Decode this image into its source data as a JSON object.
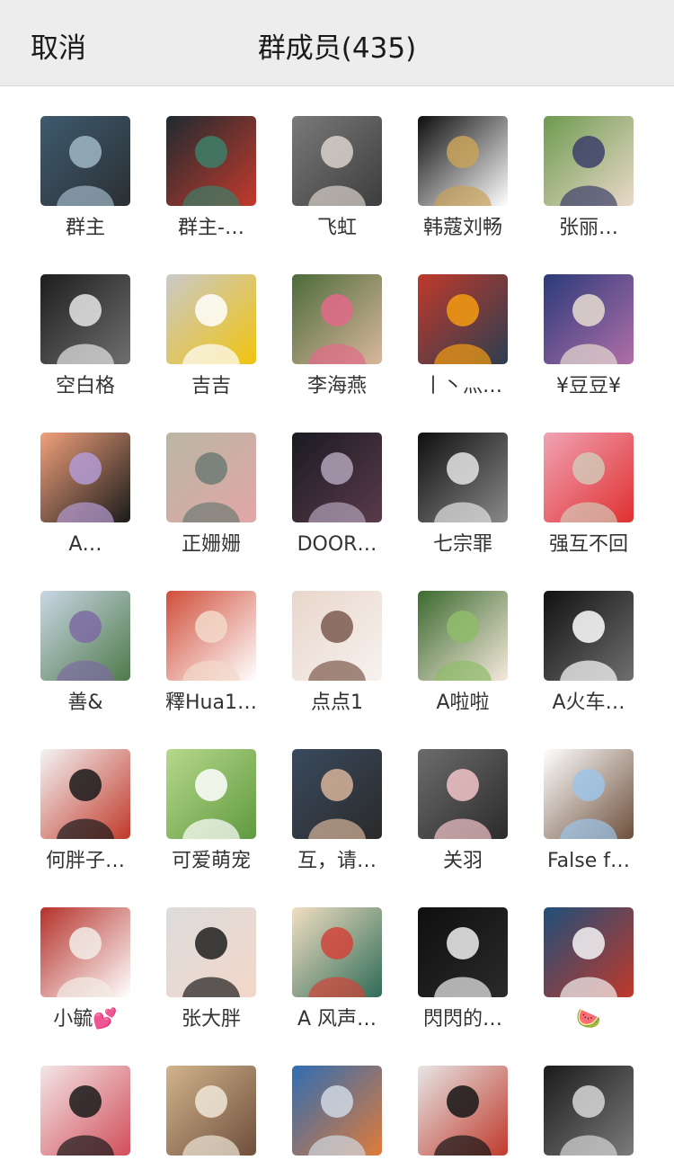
{
  "header": {
    "cancel_label": "取消",
    "title": "群成员(435)"
  },
  "members": [
    {
      "name": "群主",
      "avatar": "steering-wheel-photo",
      "palette": [
        "#3e5b6f",
        "#9fb7c6",
        "#2b2f33"
      ]
    },
    {
      "name": "群主-…",
      "avatar": "man-on-stage-photo",
      "palette": [
        "#1e2a30",
        "#3d7f6a",
        "#c33a2c"
      ]
    },
    {
      "name": "飞虹",
      "avatar": "girl-portrait-photo",
      "palette": [
        "#7a7a7a",
        "#d9d1cb",
        "#3d3d3d"
      ]
    },
    {
      "name": "韩蔻刘畅",
      "avatar": "han-korra-logo",
      "palette": [
        "#0d0d0d",
        "#c9a25a",
        "#ffffff"
      ]
    },
    {
      "name": "张丽…",
      "avatar": "family-lawn-photo",
      "palette": [
        "#6d9a4f",
        "#3c3f6a",
        "#ead9c9"
      ]
    },
    {
      "name": "空白格",
      "avatar": "bw-portrait-photo",
      "palette": [
        "#1d1d1d",
        "#e6e6e6",
        "#6f6f6f"
      ]
    },
    {
      "name": "吉吉",
      "avatar": "bunny-cartoon",
      "palette": [
        "#c9c9c9",
        "#ffffff",
        "#f1c40f"
      ]
    },
    {
      "name": "李海燕",
      "avatar": "woman-in-pink-photo",
      "palette": [
        "#4c6b3a",
        "#e26a8a",
        "#d9b79c"
      ]
    },
    {
      "name": "丨丶灬…",
      "avatar": "anime-couple-art",
      "palette": [
        "#c0392b",
        "#f39c12",
        "#2c3e50"
      ]
    },
    {
      "name": "¥豆豆¥",
      "avatar": "child-in-coat-photo",
      "palette": [
        "#2b3a7a",
        "#e7dcd2",
        "#b06fa8"
      ]
    },
    {
      "name": "A…",
      "avatar": "cartoon-girl-sunset",
      "palette": [
        "#f1a07b",
        "#b39bd3",
        "#1a1a1a"
      ]
    },
    {
      "name": "正姗姗",
      "avatar": "child-on-beach-photo",
      "palette": [
        "#b9b7a3",
        "#6d7b74",
        "#e2a6a6"
      ]
    },
    {
      "name": "DOOR…",
      "avatar": "fashion-collage-photo",
      "palette": [
        "#1a1a22",
        "#b2a2b9",
        "#5a3b4b"
      ]
    },
    {
      "name": "七宗罪",
      "avatar": "anime-boy-sketch",
      "palette": [
        "#0f0f0f",
        "#e4e4e4",
        "#8a8a8a"
      ]
    },
    {
      "name": "强互不回",
      "avatar": "mom-and-child-photo",
      "palette": [
        "#f0a3b4",
        "#d4c7b6",
        "#e03030"
      ]
    },
    {
      "name": "善&",
      "avatar": "lavender-field-photo",
      "palette": [
        "#c9d6e4",
        "#7d6ba3",
        "#4f7a4a"
      ]
    },
    {
      "name": "釋Hua1…",
      "avatar": "young-woman-selfie",
      "palette": [
        "#d14e3a",
        "#f2d9c9",
        "#ffffff"
      ]
    },
    {
      "name": "点点1",
      "avatar": "braided-hair-photo",
      "palette": [
        "#e8d6cb",
        "#7d5a4d",
        "#f7f2ef"
      ]
    },
    {
      "name": "A啦啦",
      "avatar": "deer-antler-girl-photo",
      "palette": [
        "#3c6a2f",
        "#8fbc6a",
        "#f5e9dc"
      ]
    },
    {
      "name": "A火车…",
      "avatar": "hui-jia-banner",
      "palette": [
        "#111111",
        "#ffffff",
        "#6f6f6f"
      ]
    },
    {
      "name": "何胖子…",
      "avatar": "calligraphy-chu-xin",
      "palette": [
        "#f4f4f4",
        "#1a1a1a",
        "#c0392b"
      ]
    },
    {
      "name": "可爱萌宠",
      "avatar": "wipes-package-photo",
      "palette": [
        "#b7d88b",
        "#ffffff",
        "#5f9a3f"
      ]
    },
    {
      "name": "互，请…",
      "avatar": "man-selfie-photo",
      "palette": [
        "#3a4a5f",
        "#d7b49a",
        "#2a2a2a"
      ]
    },
    {
      "name": "关羽",
      "avatar": "masked-man-photo",
      "palette": [
        "#6c6c6c",
        "#f2c4c8",
        "#2b2b2b"
      ]
    },
    {
      "name": "False f…",
      "avatar": "chibi-boy-cartoon",
      "palette": [
        "#ffffff",
        "#9cc4e8",
        "#6d4f3b"
      ]
    },
    {
      "name": "小毓💕",
      "avatar": "bride-photo",
      "palette": [
        "#b5312a",
        "#f2ece6",
        "#ffffff"
      ]
    },
    {
      "name": "张大胖",
      "avatar": "woman-selfie-photo",
      "palette": [
        "#dcdcdc",
        "#1f1f1f",
        "#f3d7c8"
      ]
    },
    {
      "name": "A 风声…",
      "avatar": "koi-fish-art",
      "palette": [
        "#f1dfc2",
        "#d0443a",
        "#2f6b57"
      ]
    },
    {
      "name": "閃閃的…",
      "avatar": "nike-shirt-photo",
      "palette": [
        "#0f0f0f",
        "#f0f0f0",
        "#2a2a2a"
      ]
    },
    {
      "name": "🍉",
      "avatar": "crescent-moon-art",
      "palette": [
        "#1f4f7a",
        "#f4f4f4",
        "#c0392b"
      ]
    },
    {
      "name": "",
      "avatar": "girl-with-flowers-photo",
      "palette": [
        "#f3e6e6",
        "#1a1a1a",
        "#d14e5a"
      ]
    },
    {
      "name": "",
      "avatar": "puppy-photo",
      "palette": [
        "#d3b48d",
        "#f0e6d8",
        "#6d4f3b"
      ]
    },
    {
      "name": "",
      "avatar": "shopping-cart-laptop",
      "palette": [
        "#2f6db3",
        "#cfd8e3",
        "#e07b39"
      ]
    },
    {
      "name": "",
      "avatar": "man-in-suit-photo",
      "palette": [
        "#e6e6e6",
        "#151515",
        "#c0392b"
      ]
    },
    {
      "name": "",
      "avatar": "sleeping-man-photo",
      "palette": [
        "#1b1b1b",
        "#d7d7d7",
        "#7b7b7b"
      ]
    }
  ]
}
